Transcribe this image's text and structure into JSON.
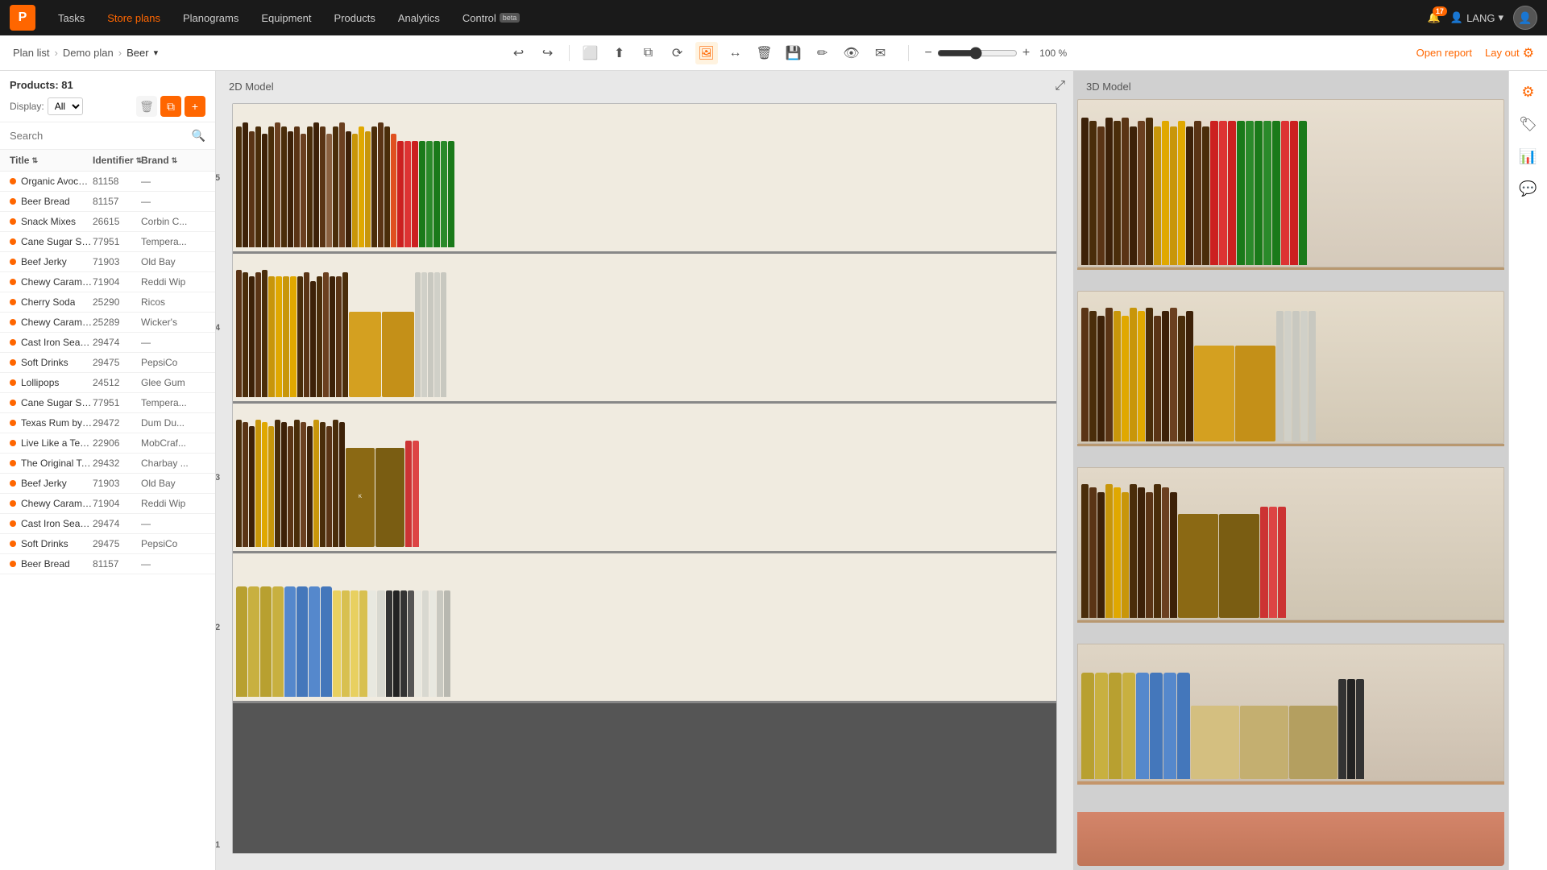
{
  "app": {
    "logo": "P",
    "nav_items": [
      {
        "label": "Tasks",
        "active": false
      },
      {
        "label": "Store plans",
        "active": true
      },
      {
        "label": "Planograms",
        "active": false
      },
      {
        "label": "Equipment",
        "active": false
      },
      {
        "label": "Products",
        "active": false
      },
      {
        "label": "Analytics",
        "active": false
      },
      {
        "label": "Control",
        "active": false,
        "beta": true
      }
    ],
    "bell_count": "17",
    "lang": "LANG"
  },
  "breadcrumb": {
    "plan_list": "Plan list",
    "demo_plan": "Demo plan",
    "current": "Beer"
  },
  "toolbar": {
    "undo_label": "↩",
    "redo_label": "↪",
    "zoom_percent": "100 %"
  },
  "top_actions": {
    "open_report": "Open report",
    "lay_out": "Lay out"
  },
  "left_panel": {
    "products_count": "Products: 81",
    "display_label": "Display:",
    "display_value": "All",
    "search_placeholder": "Search",
    "columns": [
      {
        "label": "Title",
        "key": "title"
      },
      {
        "label": "Identifier",
        "key": "id"
      },
      {
        "label": "Brand",
        "key": "brand"
      }
    ],
    "products": [
      {
        "name": "Organic Avocado Oil",
        "id": "81158",
        "brand": "—"
      },
      {
        "name": "Beer Bread",
        "id": "81157",
        "brand": "—"
      },
      {
        "name": "Snack Mixes",
        "id": "26615",
        "brand": "Corbin C..."
      },
      {
        "name": "Cane Sugar Sodas",
        "id": "77951",
        "brand": "Tempera..."
      },
      {
        "name": "Beef Jerky",
        "id": "71903",
        "brand": "Old Bay"
      },
      {
        "name": "Chewy Caramels with a Cr...",
        "id": "71904",
        "brand": "Reddi Wip"
      },
      {
        "name": "Cherry Soda",
        "id": "25290",
        "brand": "Ricos"
      },
      {
        "name": "Chewy Caramel Snack Stic...",
        "id": "25289",
        "brand": "Wicker's"
      },
      {
        "name": "Cast Iron Seasoning",
        "id": "29474",
        "brand": "—"
      },
      {
        "name": "Soft Drinks",
        "id": "29475",
        "brand": "PepsiCo"
      },
      {
        "name": "Lollipops",
        "id": "24512",
        "brand": "Glee Gum"
      },
      {
        "name": "Cane Sugar Sodas",
        "id": "77951",
        "brand": "Tempera..."
      },
      {
        "name": "Texas Rum by Kiepersol",
        "id": "29472",
        "brand": "Dum Du..."
      },
      {
        "name": "Live Like a Texan",
        "id": "22906",
        "brand": "MobCraf..."
      },
      {
        "name": "The Original Texas Whisky",
        "id": "29432",
        "brand": "Charbay ..."
      },
      {
        "name": "Beef Jerky",
        "id": "71903",
        "brand": "Old Bay"
      },
      {
        "name": "Chewy Caramels with a Cr...",
        "id": "71904",
        "brand": "Reddi Wip"
      },
      {
        "name": "Cast Iron Seasoning",
        "id": "29474",
        "brand": "—"
      },
      {
        "name": "Soft Drinks",
        "id": "29475",
        "brand": "PepsiCo"
      },
      {
        "name": "Beer Bread",
        "id": "81157",
        "brand": "—"
      }
    ]
  },
  "model_2d": {
    "label": "2D Model",
    "shelf_numbers": [
      "5",
      "4",
      "3",
      "2",
      "1"
    ]
  },
  "model_3d": {
    "label": "3D Model"
  },
  "right_sidebar": {
    "icons": [
      "gear",
      "tag",
      "chart",
      "comment"
    ]
  }
}
